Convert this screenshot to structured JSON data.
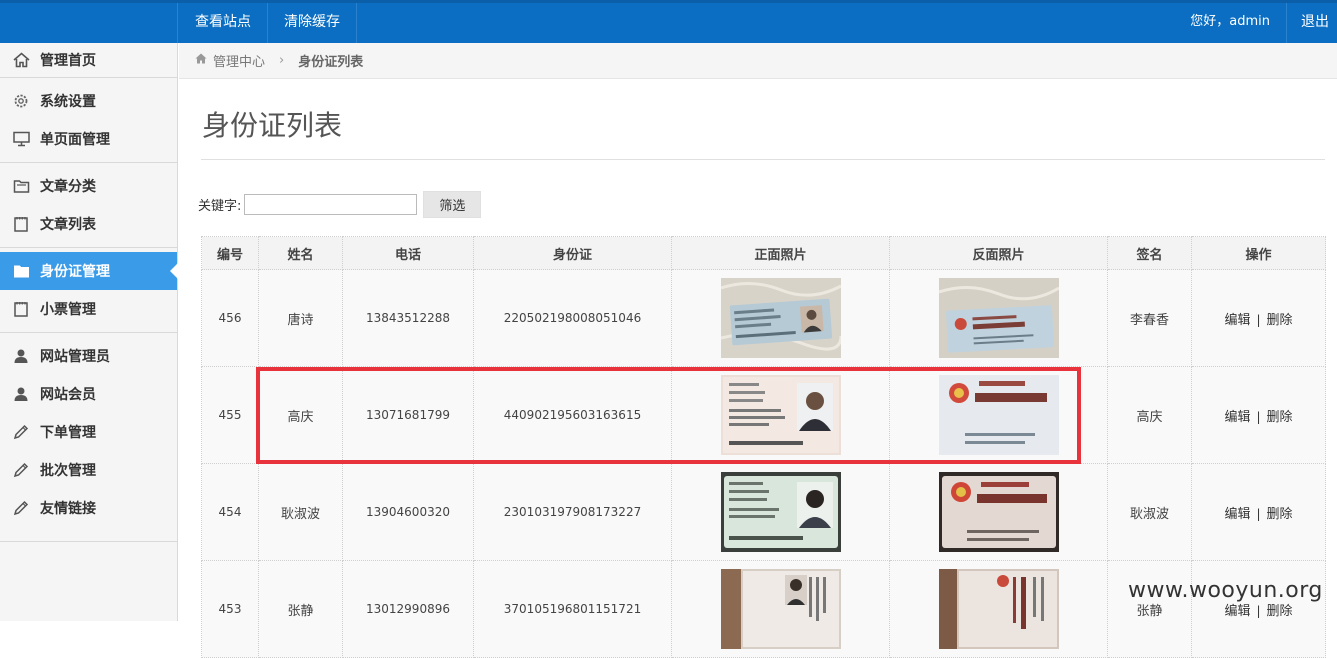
{
  "topbar": {
    "nav": [
      "查看站点",
      "清除缓存"
    ],
    "greeting": "您好，admin",
    "logout": "退出"
  },
  "sidebar": {
    "items": [
      {
        "label": "管理首页",
        "icon": "home-icon"
      },
      {
        "label": "系统设置",
        "icon": "gear-icon"
      },
      {
        "label": "单页面管理",
        "icon": "monitor-icon"
      },
      {
        "label": "文章分类",
        "icon": "folder-icon"
      },
      {
        "label": "文章列表",
        "icon": "notepad-icon"
      },
      {
        "label": "身份证管理",
        "icon": "folder-icon"
      },
      {
        "label": "小票管理",
        "icon": "notepad-icon"
      },
      {
        "label": "网站管理员",
        "icon": "user-icon"
      },
      {
        "label": "网站会员",
        "icon": "user-icon"
      },
      {
        "label": "下单管理",
        "icon": "pencil-icon"
      },
      {
        "label": "批次管理",
        "icon": "pencil-icon"
      },
      {
        "label": "友情链接",
        "icon": "pencil-icon"
      }
    ],
    "active_index": 5
  },
  "breadcrumb": {
    "root": "管理中心",
    "current": "身份证列表"
  },
  "page": {
    "title": "身份证列表",
    "keyword_label": "关键字:",
    "keyword_value": "",
    "filter_button": "筛选"
  },
  "table": {
    "headers": [
      "编号",
      "姓名",
      "电话",
      "身份证",
      "正面照片",
      "反面照片",
      "签名",
      "操作"
    ],
    "edit_label": "编辑",
    "delete_label": "删除",
    "rows": [
      {
        "id": "456",
        "name": "唐诗",
        "phone": "13843512288",
        "idno": "220502198008051046",
        "sign": "李春香"
      },
      {
        "id": "455",
        "name": "高庆",
        "phone": "13071681799",
        "idno": "440902195603163615",
        "sign": "高庆"
      },
      {
        "id": "454",
        "name": "耿淑波",
        "phone": "13904600320",
        "idno": "230103197908173227",
        "sign": "耿淑波"
      },
      {
        "id": "453",
        "name": "张静",
        "phone": "13012990896",
        "idno": "370105196801151721",
        "sign": "张静"
      }
    ]
  },
  "colors": {
    "topbar": "#0b6ec2",
    "active": "#3a9be8",
    "highlight": "#e8323c"
  },
  "watermark": "www.wooyun.org"
}
